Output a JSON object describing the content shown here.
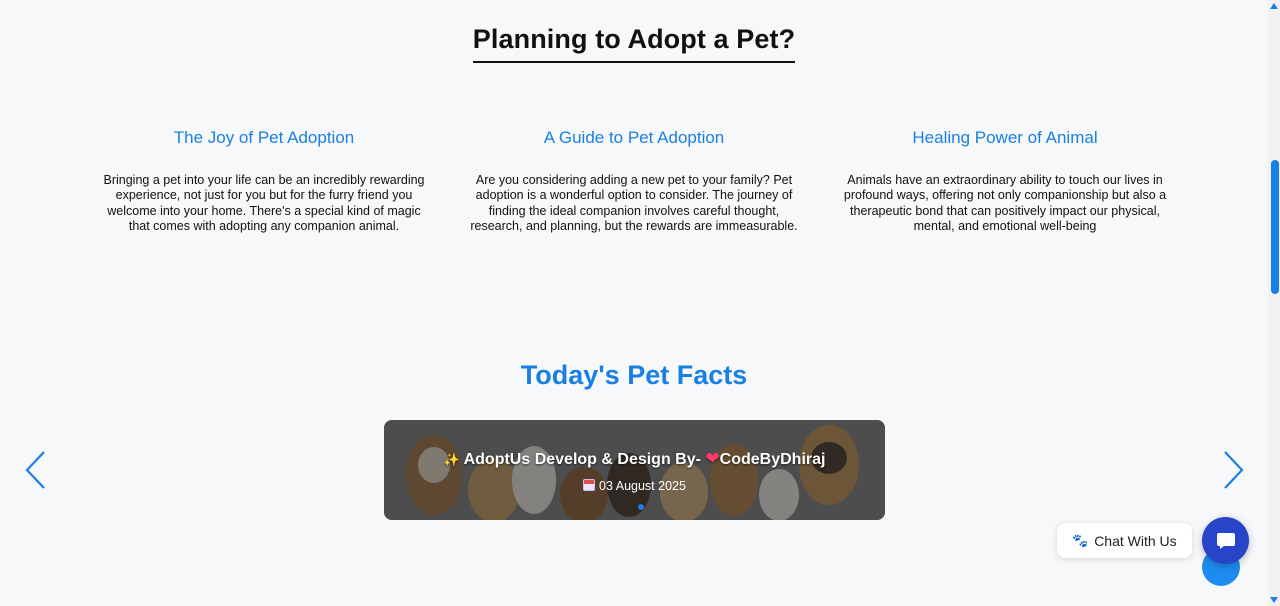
{
  "header": {
    "title": "Planning to Adopt a Pet?"
  },
  "info_cards": [
    {
      "title": "The Joy of Pet Adoption",
      "text": "Bringing a pet into your life can be an incredibly rewarding experience, not just for you but for the furry friend you welcome into your home. There's a special kind of magic that comes with adopting any companion animal."
    },
    {
      "title": "A Guide to Pet Adoption",
      "text": "Are you considering adding a new pet to your family? Pet adoption is a wonderful option to consider. The journey of finding the ideal companion involves careful thought, research, and planning, but the rewards are immeasurable."
    },
    {
      "title": "Healing Power of Animal",
      "text": "Animals have an extraordinary ability to touch our lives in profound ways, offering not only companionship but also a therapeutic bond that can positively impact our physical, mental, and emotional well-being"
    }
  ],
  "facts": {
    "title": "Today's Pet Facts",
    "slide": {
      "prefix": "AdoptUs Develop & Design By-",
      "heart": "❤",
      "author": "CodeByDhiraj",
      "date": "03 August 2025"
    },
    "prev_icon": "chevron-left-icon",
    "next_icon": "chevron-right-icon"
  },
  "chat": {
    "label": "Chat With Us",
    "paw": "🐾"
  },
  "colors": {
    "accent": "#1a7fe3",
    "chat_button": "#2845c9",
    "background": "#f7f8fa"
  }
}
